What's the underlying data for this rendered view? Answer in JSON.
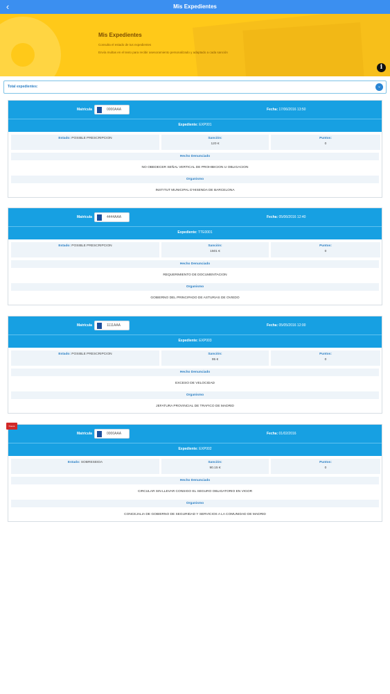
{
  "appbar": {
    "title": "Mis Expedientes",
    "back_glyph": "‹"
  },
  "hero": {
    "title": "Mis Expedientes",
    "line1": "Consulta el estado de tus expedientes",
    "line2": "Envía multas en el texto para recibir asesoramiento personalizado y adaptado a cada sanción"
  },
  "total": {
    "label": "Total expedientes:"
  },
  "labels": {
    "matricula": "Matrícula",
    "fecha": "Fecha:",
    "expediente": "Expediente:",
    "estado": "Estado:",
    "sancion": "Sanción:",
    "puntos": "Puntos:",
    "hecho": "Hecho Denunciado",
    "organismo": "Organismo"
  },
  "cards": [
    {
      "matricula": "0000AAA",
      "fecha": "17/06/2016 13:50",
      "expediente": "EXP001",
      "estado": "POSIBLE PRESCRIPCION",
      "sancion": "120 €",
      "puntos": "0",
      "hecho": "NO OBEDECER SEÑAL VERTICAL DE PROHIBICION U OBLIGACION",
      "organismo": "INSTITUT MUNICIPAL D'HISENDA DE BARCELONA"
    },
    {
      "matricula": "4444AAA",
      "fecha": "05/06/2016 12:40",
      "expediente": "TTE0001",
      "estado": "POSIBLE PRESCRIPCION",
      "sancion": "1501 €",
      "puntos": "0",
      "hecho": "REQUERIMIENTO DE DOCUMENTACION",
      "organismo": "GOBIERNO DEL PRINCIPADO DE ASTURIAS DE OVIEDO"
    },
    {
      "matricula": "1111AAA",
      "fecha": "05/05/2016 12:00",
      "expediente": "EXP003",
      "estado": "POSIBLE PRESCRIPCION",
      "sancion": "95 €",
      "puntos": "0",
      "hecho": "EXCESO DE VELOCIDAD",
      "organismo": "JEFATURA PROVINCIAL DE TRAFICO DE MADRID"
    },
    {
      "matricula": "0000AAA",
      "fecha": "01/02/2016",
      "expediente": "EXP002",
      "estado": "SOBRESEIDA",
      "sancion": "90.15 €",
      "puntos": "0",
      "hecho": "CIRCULAR SIN LLEVAR CONSIGO EL SEGURO OBLIGATORIO EN VIGOR",
      "organismo": "CONCEJALIA DE GOBIERNO DE SEGURIDAD Y SERVICIOS A LA COMUNIDAD DE MADRID",
      "ribbon": "Nueva"
    }
  ]
}
